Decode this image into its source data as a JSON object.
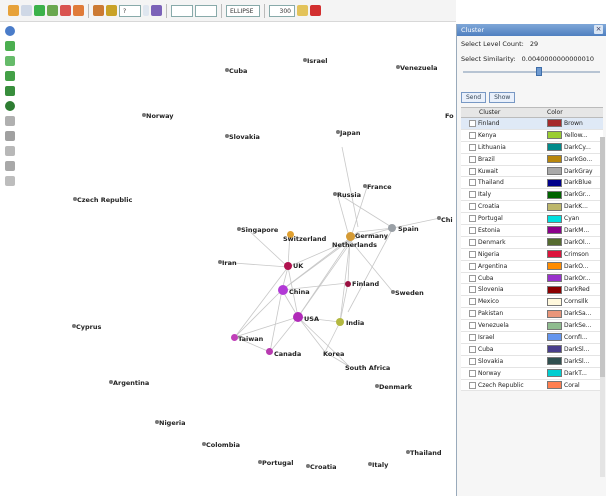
{
  "toolbar": {
    "zoom_value": "?",
    "shape_select": "ELLIPSE",
    "size_value": "300"
  },
  "panel": {
    "title": "Cluster",
    "close_label": "×",
    "level_count_label": "Select Level Count:",
    "level_count_value": "29",
    "similarity_label": "Select Similarity:",
    "similarity_value": "0.0040000000000010",
    "slider_fraction": 0.53,
    "btn_1": "Send",
    "btn_2": "Show",
    "col_cluster": "Cluster",
    "col_color": "Color",
    "rows": [
      {
        "name": "Finland",
        "color_name": "Brown",
        "color": "#a52a2a"
      },
      {
        "name": "Kenya",
        "color_name": "Yellow...",
        "color": "#9acd32"
      },
      {
        "name": "Lithuania",
        "color_name": "DarkCy...",
        "color": "#008b8b"
      },
      {
        "name": "Brazil",
        "color_name": "DarkGo...",
        "color": "#b8860b"
      },
      {
        "name": "Kuwait",
        "color_name": "DarkGray",
        "color": "#a9a9a9"
      },
      {
        "name": "Thailand",
        "color_name": "DarkBlue",
        "color": "#00008b"
      },
      {
        "name": "Italy",
        "color_name": "DarkGr...",
        "color": "#006400"
      },
      {
        "name": "Croatia",
        "color_name": "DarkK...",
        "color": "#bdb76b"
      },
      {
        "name": "Portugal",
        "color_name": "Cyan",
        "color": "#00e0e0"
      },
      {
        "name": "Estonia",
        "color_name": "DarkM...",
        "color": "#8b008b"
      },
      {
        "name": "Denmark",
        "color_name": "DarkOl...",
        "color": "#556b2f"
      },
      {
        "name": "Nigeria",
        "color_name": "Crimson",
        "color": "#dc143c"
      },
      {
        "name": "Argentina",
        "color_name": "DarkO...",
        "color": "#ff8c00"
      },
      {
        "name": "Cuba",
        "color_name": "DarkOr...",
        "color": "#9932cc"
      },
      {
        "name": "Slovenia",
        "color_name": "DarkRed",
        "color": "#8b0000"
      },
      {
        "name": "Mexico",
        "color_name": "CornsIlk",
        "color": "#fff8dc"
      },
      {
        "name": "Pakistan",
        "color_name": "DarkSa...",
        "color": "#e9967a"
      },
      {
        "name": "Venezuela",
        "color_name": "DarkSe...",
        "color": "#8fbc8f"
      },
      {
        "name": "Israel",
        "color_name": "CornfI...",
        "color": "#6495ed"
      },
      {
        "name": "Cuba",
        "color_name": "DarkSl...",
        "color": "#483d8b"
      },
      {
        "name": "Slovakia",
        "color_name": "DarkSl...",
        "color": "#2f4f4f"
      },
      {
        "name": "Norway",
        "color_name": "DarkT...",
        "color": "#00ced1"
      },
      {
        "name": "Czech Republic",
        "color_name": "Coral",
        "color": "#ff7f50"
      }
    ]
  },
  "graph": {
    "labels": {
      "Israel": "Israel",
      "Cuba": "Cuba",
      "Venezuela": "Venezuela",
      "Norway": "Norway",
      "Slovakia": "Slovakia",
      "Japan": "Japan",
      "France": "France",
      "Russia": "Russia",
      "Czech_Republic": "Czech Republic",
      "Singapore": "Singapore",
      "Switzerland": "Switzerland",
      "Germany": "Germany",
      "Netherlands": "Netherlands",
      "Spain": "Spain",
      "Chi": "Chi",
      "Iran": "Iran",
      "UK": "UK",
      "Finland": "Finland",
      "China": "China",
      "Sweden": "Sweden",
      "Cyprus": "Cyprus",
      "USA": "USA",
      "India": "India",
      "Taiwan": "Taiwan",
      "Canada": "Canada",
      "Korea": "Korea",
      "South_Africa": "South Africa",
      "Argentina": "Argentina",
      "Denmark": "Denmark",
      "Nigeria": "Nigeria",
      "Colombia": "Colombia",
      "Thailand": "Thailand",
      "Portugal": "Portugal",
      "Croatia": "Croatia",
      "Italy": "Italy",
      "Fo": "Fo"
    }
  }
}
